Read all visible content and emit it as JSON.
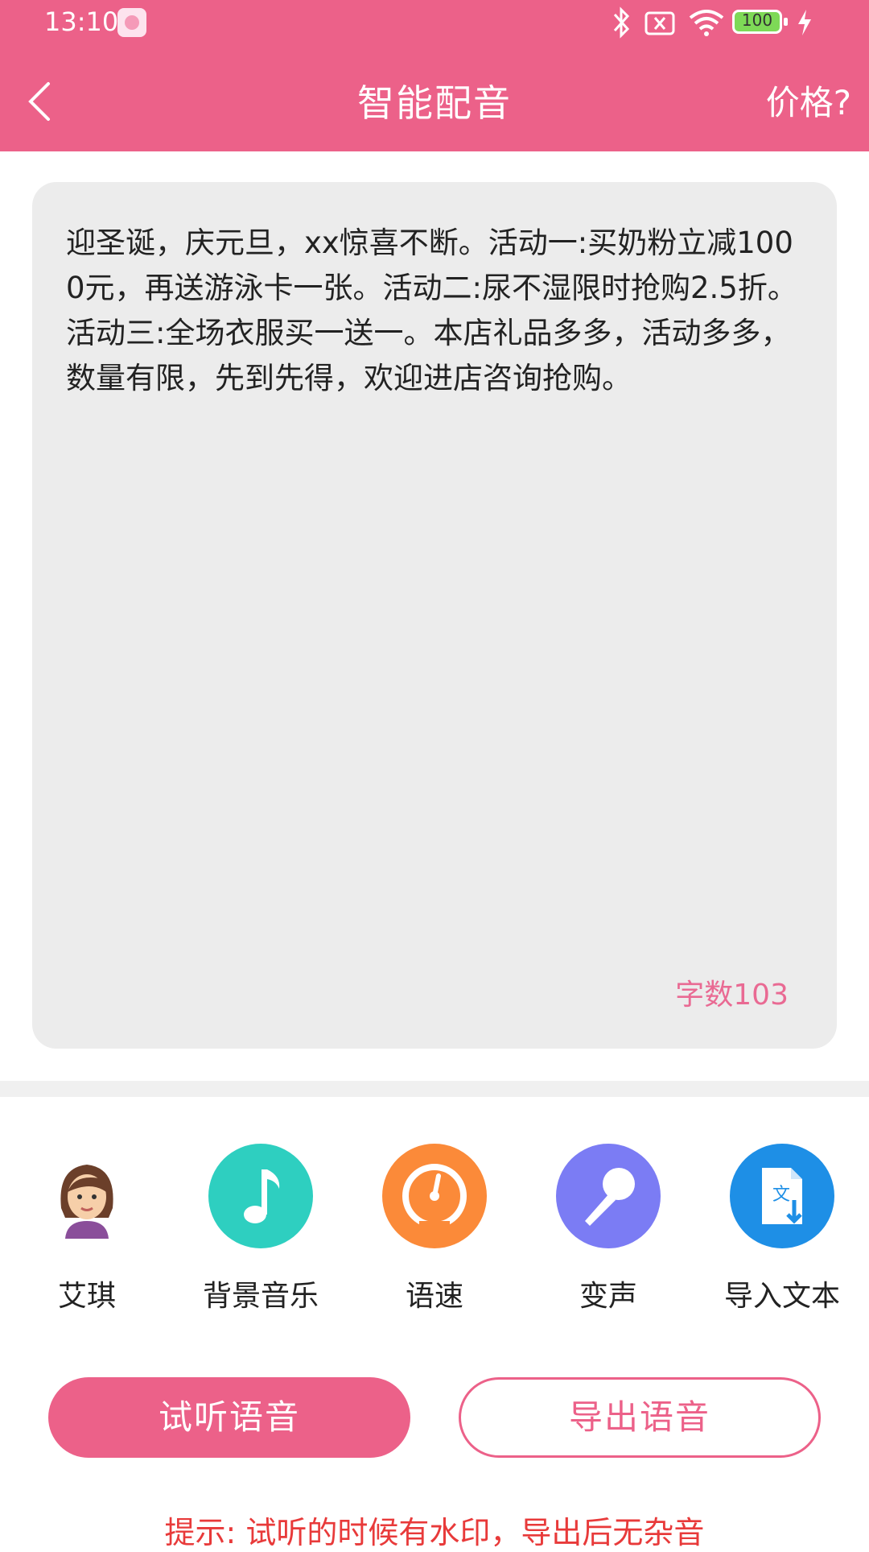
{
  "status_bar": {
    "time": "13:10",
    "battery": "100",
    "icons": [
      "bluetooth-icon",
      "sim-none-icon",
      "wifi-icon",
      "battery-icon",
      "charging-icon"
    ]
  },
  "nav": {
    "back_icon": "chevron-left-icon",
    "title": "智能配音",
    "price_label": "价格?"
  },
  "editor": {
    "text": "迎圣诞，庆元旦，xx惊喜不断。活动一:买奶粉立减1000元，再送游泳卡一张。活动二:尿不湿限时抢购2.5折。活动三:全场衣服买一送一。本店礼品多多，活动多多，数量有限，先到先得，欢迎进店咨询抢购。",
    "char_count": "字数103"
  },
  "tools": [
    {
      "label": "艾琪",
      "icon": "voice-avatar-icon"
    },
    {
      "label": "背景音乐",
      "icon": "music-note-icon",
      "color": "#2ecfc0"
    },
    {
      "label": "语速",
      "icon": "speedometer-icon",
      "color": "#fb8a39"
    },
    {
      "label": "变声",
      "icon": "microphone-icon",
      "color": "#7b7cf4"
    },
    {
      "label": "导入文本",
      "icon": "import-document-icon",
      "color": "#1e8fe6"
    }
  ],
  "actions": {
    "preview_label": "试听语音",
    "export_label": "导出语音"
  },
  "hint": "提示: 试听的时候有水印，导出后无杂音",
  "colors": {
    "brand": "#ec6189",
    "hint": "#e83a3a",
    "panel": "#ececec"
  }
}
